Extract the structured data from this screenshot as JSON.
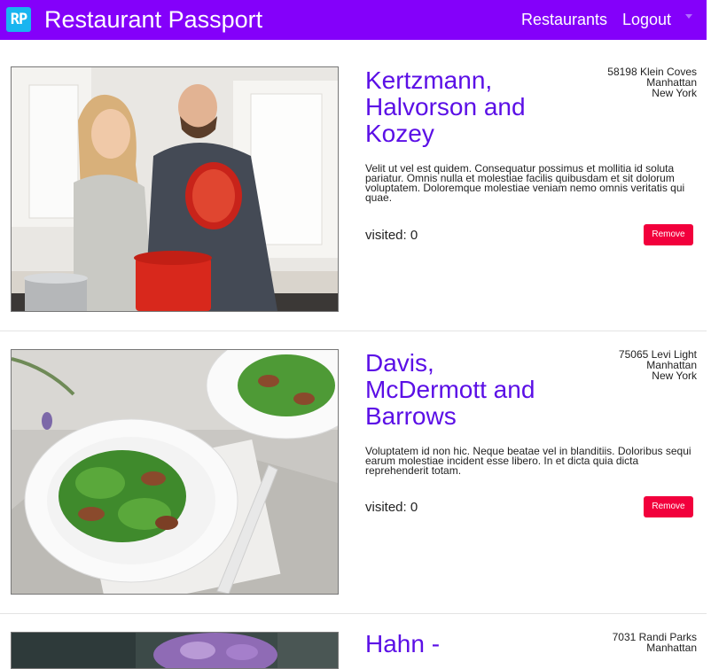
{
  "navbar": {
    "logo_text": "RP",
    "title": "Restaurant Passport",
    "links": {
      "restaurants": "Restaurants",
      "logout": "Logout"
    },
    "background": "#8400fa",
    "logo_color": "#19b5f0"
  },
  "restaurants": [
    {
      "name": "Kertzmann, Halvorson and Kozey",
      "address": {
        "street": "58198 Klein Coves",
        "city": "Manhattan",
        "state": "New York"
      },
      "description": "Velit ut vel est quidem. Consequatur possimus et mollitia id soluta pariatur. Omnis nulla et molestiae facilis quibusdam et sit dolorum voluptatem. Doloremque molestiae veniam nemo omnis veritatis qui quae.",
      "visited": "visited: 0",
      "remove_label": "Remove",
      "image": "couple-cooking-photo"
    },
    {
      "name": "Davis, McDermott and Barrows",
      "address": {
        "street": "75065 Levi Light",
        "city": "Manhattan",
        "state": "New York"
      },
      "description": "Voluptatem id non hic. Neque beatae vel in blanditiis. Doloribus sequi earum molestiae incident esse libero. In et dicta quia dicta reprehenderit totam.",
      "visited": "visited: 0",
      "remove_label": "Remove",
      "image": "salad-plate-photo"
    },
    {
      "name": "Hahn -",
      "address": {
        "street": "7031 Randi Parks",
        "city": "Manhattan"
      },
      "image": "flowers-photo"
    }
  ],
  "colors": {
    "title": "#5b0fe6",
    "remove_button": "#f2003c"
  }
}
